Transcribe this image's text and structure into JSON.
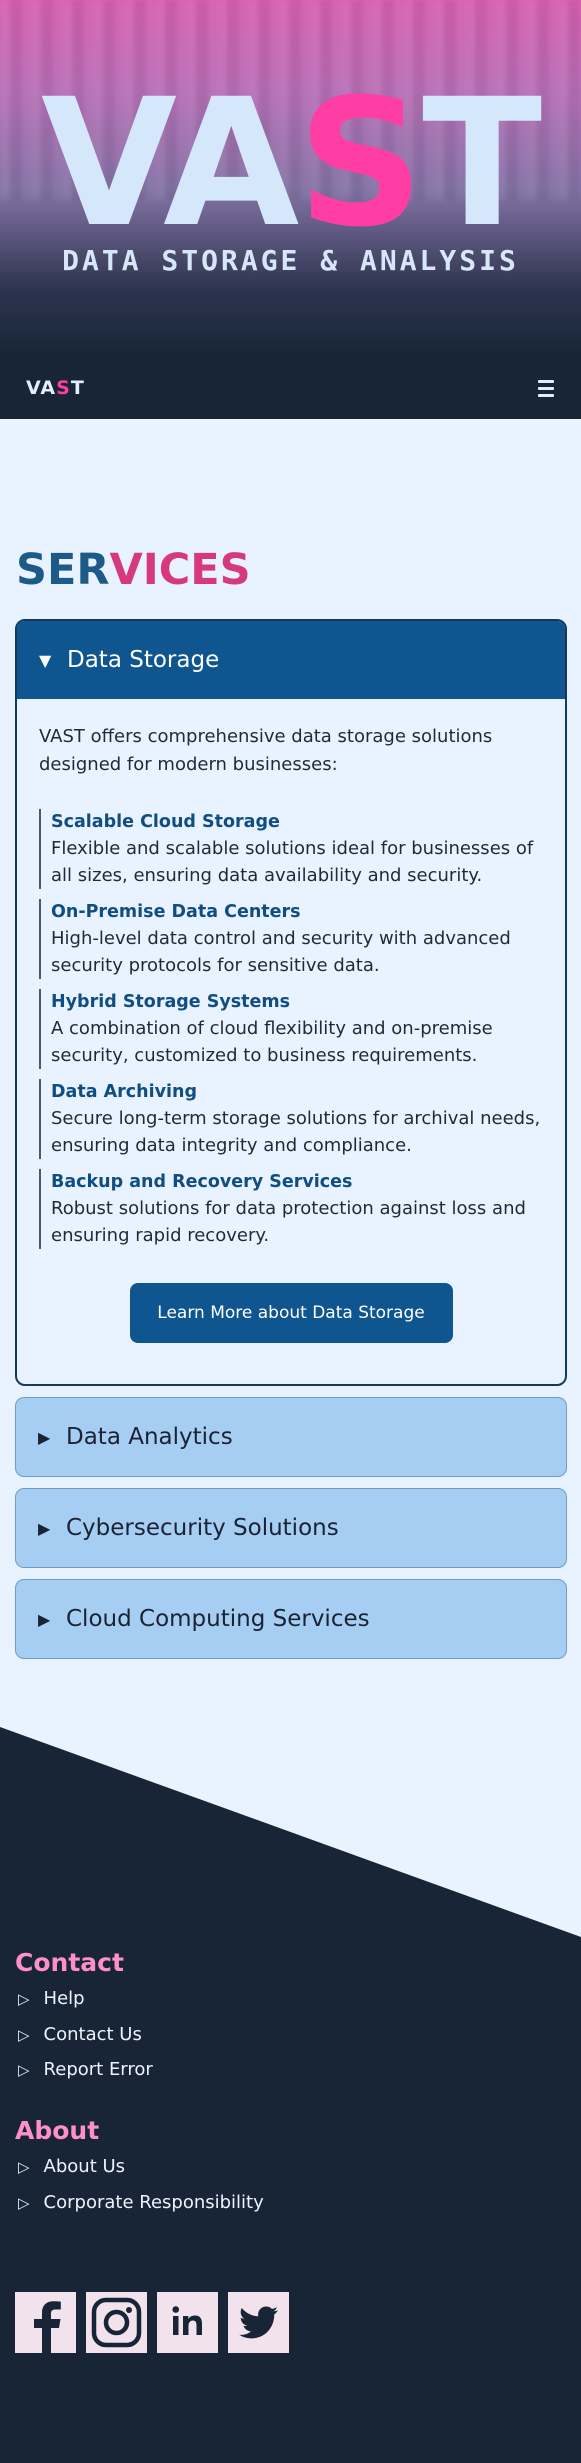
{
  "hero": {
    "title_part1": "VA",
    "title_highlight": "S",
    "title_part2": "T",
    "subtitle": "DATA STORAGE & ANALYSIS"
  },
  "navbar": {
    "logo_part1": "VA",
    "logo_highlight": "S",
    "logo_part2": "T",
    "menu_icon": "hamburger-icon"
  },
  "services": {
    "title_part1": "SER",
    "title_part2": "VICES",
    "open_panel": {
      "title": "Data Storage",
      "intro": "VAST offers comprehensive data storage solutions designed for modern businesses:",
      "items": [
        {
          "title": "Scalable Cloud Storage",
          "desc": "Flexible and scalable solutions ideal for businesses of all sizes, ensuring data availability and security."
        },
        {
          "title": "On-Premise Data Centers",
          "desc": "High-level data control and security with advanced security protocols for sensitive data."
        },
        {
          "title": "Hybrid Storage Systems",
          "desc": "A combination of cloud flexibility and on-premise security, customized to business requirements."
        },
        {
          "title": "Data Archiving",
          "desc": "Secure long-term storage solutions for archival needs, ensuring data integrity and compliance."
        },
        {
          "title": "Backup and Recovery Services",
          "desc": "Robust solutions for data protection against loss and ensuring rapid recovery."
        }
      ],
      "button_label": "Learn More about Data Storage"
    },
    "closed_panels": [
      {
        "title": "Data Analytics"
      },
      {
        "title": "Cybersecurity Solutions"
      },
      {
        "title": "Cloud Computing Services"
      }
    ]
  },
  "footer": {
    "contact": {
      "heading": "Contact",
      "links": [
        "Help",
        "Contact Us",
        "Report Error"
      ]
    },
    "about": {
      "heading": "About",
      "links": [
        "About Us",
        "Corporate Responsibility"
      ]
    },
    "social_icons": [
      "facebook-icon",
      "instagram-icon",
      "linkedin-icon",
      "twitter-icon"
    ]
  },
  "colors": {
    "accent_pink": "#ff3ea5",
    "brand_blue": "#0f5590",
    "footer_bg": "#172537",
    "panel_closed_bg": "#a6cef3",
    "footer_heading": "#ff8fc8"
  }
}
